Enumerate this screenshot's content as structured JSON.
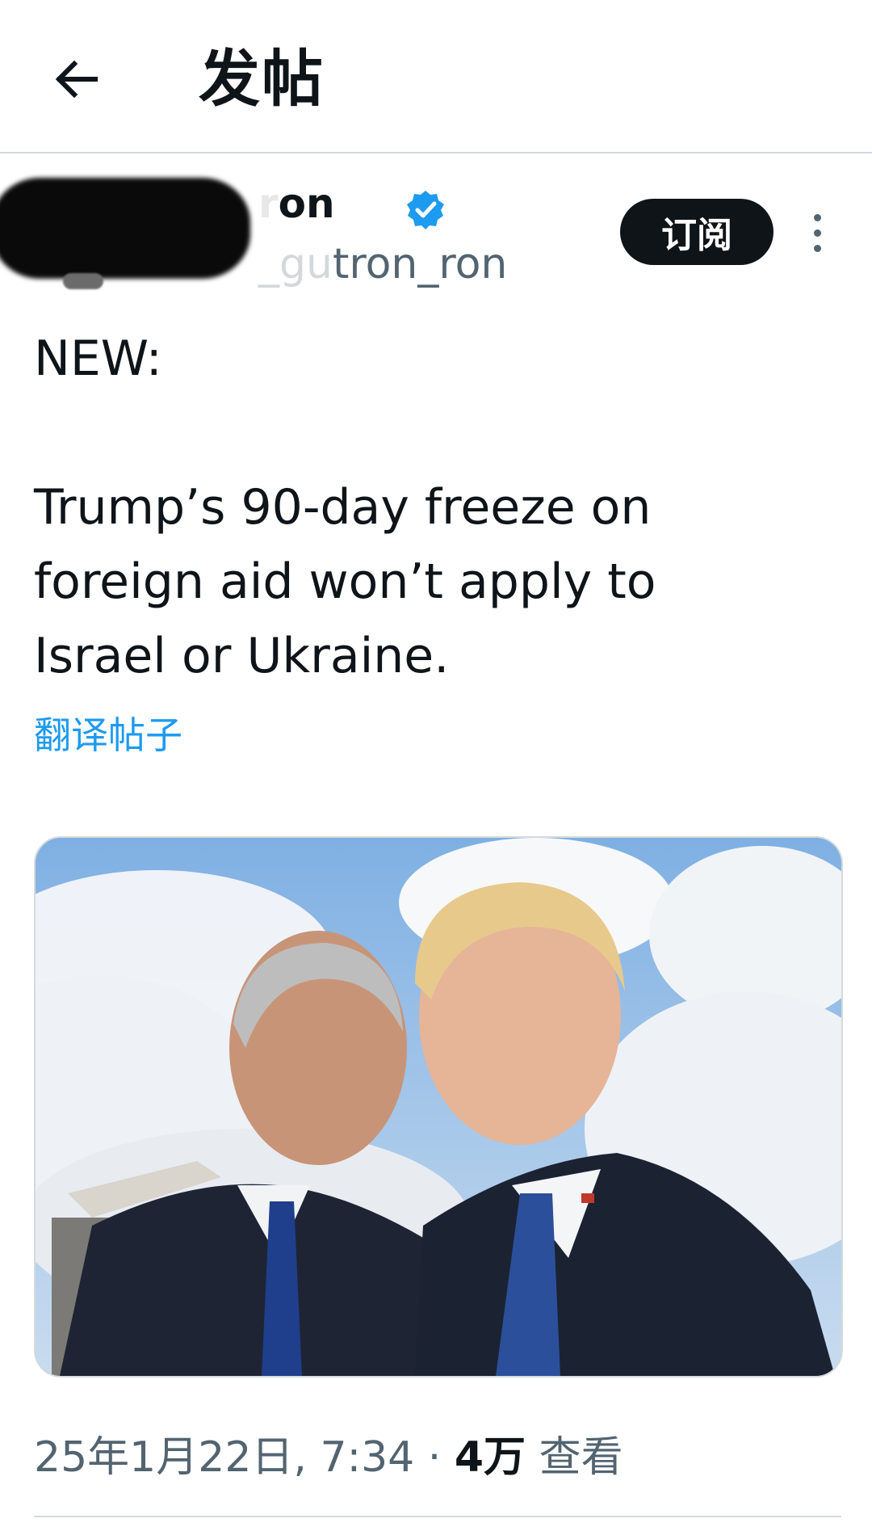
{
  "header": {
    "title": "发帖",
    "back_icon": "arrow-left-icon"
  },
  "author": {
    "display_name_visible": "on",
    "display_name_faded": "r",
    "handle_faded": "_gu",
    "handle_visible": "tron_ron",
    "verified_icon": "verified-badge-icon",
    "verified_color": "#1d9bf0",
    "subscribe_label": "订阅",
    "more_icon": "more-vertical-icon"
  },
  "post": {
    "text": "NEW:\n\nTrump’s 90-day freeze on\nforeign aid won’t apply to\nIsrael or Ukraine.",
    "translate_label": "翻译帖子",
    "link_color": "#1d9bf0"
  },
  "media": {
    "type": "photo"
  },
  "meta": {
    "timestamp": "25年1月22日, 7:34",
    "separator": "·",
    "views_count": "4万",
    "views_label": "查看"
  }
}
